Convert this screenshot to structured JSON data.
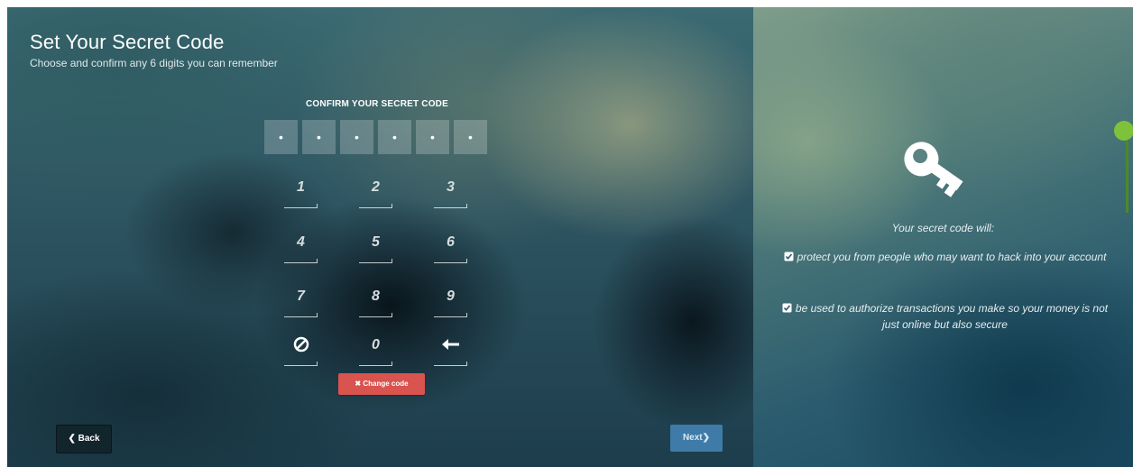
{
  "page": {
    "title": "Set Your Secret Code",
    "subtitle": "Choose and confirm any 6 digits you can remember"
  },
  "code": {
    "label": "CONFIRM YOUR SECRET CODE",
    "boxes": [
      "•",
      "•",
      "•",
      "•",
      "•",
      "•"
    ]
  },
  "keypad": {
    "k1": "1",
    "k2": "2",
    "k3": "3",
    "k4": "4",
    "k5": "5",
    "k6": "6",
    "k7": "7",
    "k8": "8",
    "k9": "9",
    "k0": "0"
  },
  "buttons": {
    "change_code": "Change code",
    "back": "Back",
    "next": "Next"
  },
  "info": {
    "heading": "Your secret code will:",
    "item1": "protect you from people who may want to hack into your account",
    "item2": "be used to authorize transactions you make so your money is not just online but also secure"
  },
  "icons": {
    "key": "key-icon",
    "clear": "clear-icon",
    "backspace": "backspace-arrow-icon",
    "check": "checkbox-icon",
    "times": "times-icon",
    "chevron_left": "chevron-left-icon",
    "chevron_right": "chevron-right-icon"
  },
  "colors": {
    "change_button": "#d9534f",
    "next_button": "#3f7ba8",
    "back_button": "#12242c",
    "scroll_handle": "#7ec23b"
  }
}
